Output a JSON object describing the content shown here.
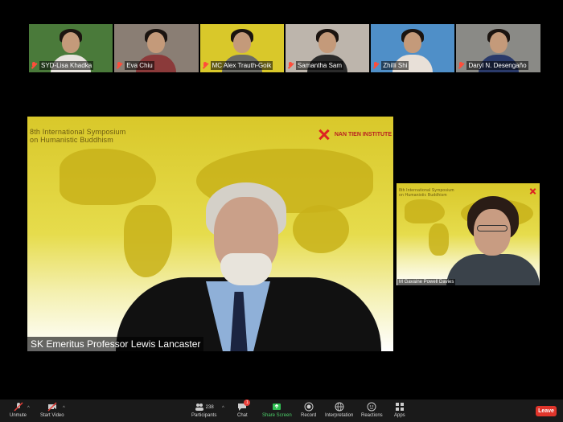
{
  "participants_strip": [
    {
      "name": "SYD-Lisa Khadka",
      "bg": "#4a7a3a",
      "torso": "#e8e4de"
    },
    {
      "name": "Eva Chiu",
      "bg": "#8a7e74",
      "torso": "#8b3a3a"
    },
    {
      "name": "MC Alex Trauth-Goik",
      "bg": "#d9c82a",
      "torso": "#6a6a64"
    },
    {
      "name": "Samantha Sam",
      "bg": "#bdb5ac",
      "torso": "#2a2a2a"
    },
    {
      "name": "Zhilli Shi",
      "bg": "#4f8fc8",
      "torso": "#e8e0d8"
    },
    {
      "name": "Daryl N. Desengaño",
      "bg": "#8a8a86",
      "torso": "#2a3a6a"
    }
  ],
  "main_speaker": {
    "slide_title_line1": "8th International Symposium",
    "slide_title_line2": "on Humanistic Buddhism",
    "logo_text": "NAN TIEN INSTITUTE",
    "name": "SK Emeritus Professor Lewis Lancaster"
  },
  "side_speaker": {
    "slide_title_line1": "8th International Symposium",
    "slide_title_line2": "on Humanistic Buddhism",
    "name": "M Gavaine Powell Davies"
  },
  "toolbar": {
    "unmute": "Unmute",
    "start_video": "Start Video",
    "participants": "Participants",
    "participant_count": "238",
    "chat": "Chat",
    "chat_badge": "1",
    "share_screen": "Share Screen",
    "record": "Record",
    "interpretation": "Interpretation",
    "reactions": "Reactions",
    "apps": "Apps",
    "leave": "Leave"
  }
}
